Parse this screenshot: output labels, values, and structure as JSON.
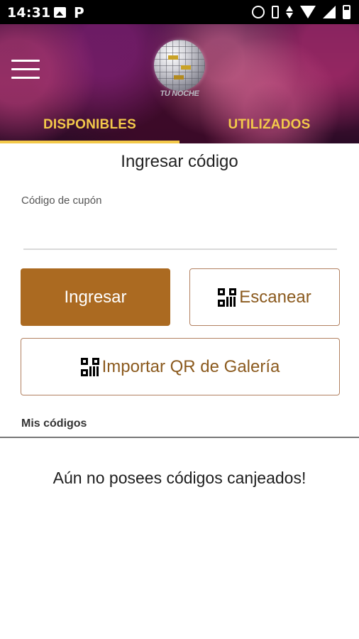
{
  "status_bar": {
    "time": "14:31",
    "left_icons": [
      "image-icon",
      "p-icon"
    ],
    "p_glyph": "P",
    "right_icons": [
      "alarm-icon",
      "vibrate-icon",
      "data-arrows-icon",
      "wifi-icon",
      "signal-icon",
      "battery-icon"
    ]
  },
  "header": {
    "menu_icon": "hamburger-menu-icon",
    "logo_text": "TU NOCHE",
    "tabs": [
      {
        "label": "DISPONIBLES",
        "active": true
      },
      {
        "label": "UTILIZADOS",
        "active": false
      }
    ],
    "accent_color": "#f3c94a"
  },
  "main": {
    "title": "Ingresar código",
    "coupon_field": {
      "label": "Código de cupón",
      "value": "",
      "placeholder": ""
    },
    "buttons": {
      "ingresar": "Ingresar",
      "escanear": "Escanear",
      "importar": "Importar QR de Galería"
    },
    "primary_color": "#ab6a21",
    "my_codes_label": "Mis códigos",
    "empty_message": "Aún no posees códigos canjeados!"
  }
}
